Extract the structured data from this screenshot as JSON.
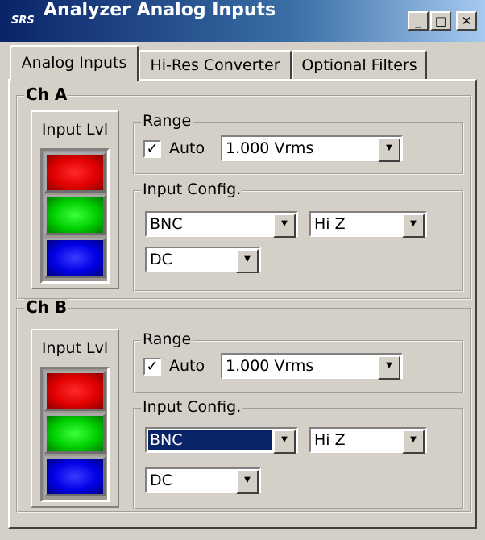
{
  "window": {
    "title": "Analyzer Analog Inputs",
    "logo_text": "SRS",
    "minimize_glyph": "_",
    "maximize_glyph": "□",
    "close_glyph": "✕"
  },
  "tabs": [
    {
      "label": "Analog Inputs",
      "active": true
    },
    {
      "label": "Hi-Res Converter",
      "active": false
    },
    {
      "label": "Optional Filters",
      "active": false
    }
  ],
  "channels": {
    "a": {
      "label": "Ch A",
      "input_level_label": "Input Lvl",
      "range": {
        "label": "Range",
        "auto_label": "Auto",
        "auto_checked": true,
        "value": "1.000 Vrms"
      },
      "input_config": {
        "label": "Input Config.",
        "source": "BNC",
        "impedance": "Hi Z",
        "coupling": "DC"
      }
    },
    "b": {
      "label": "Ch B",
      "input_level_label": "Input Lvl",
      "range": {
        "label": "Range",
        "auto_label": "Auto",
        "auto_checked": true,
        "value": "1.000 Vrms"
      },
      "input_config": {
        "label": "Input Config.",
        "source": "BNC",
        "impedance": "Hi Z",
        "coupling": "DC"
      }
    }
  },
  "glyphs": {
    "check": "✓",
    "dropdown_arrow": "▼"
  },
  "colors": {
    "title_bar": "#0a246a",
    "meter_red": "#e00000",
    "meter_green": "#00d000",
    "meter_blue": "#0000e6",
    "selection": "#0a246a"
  }
}
